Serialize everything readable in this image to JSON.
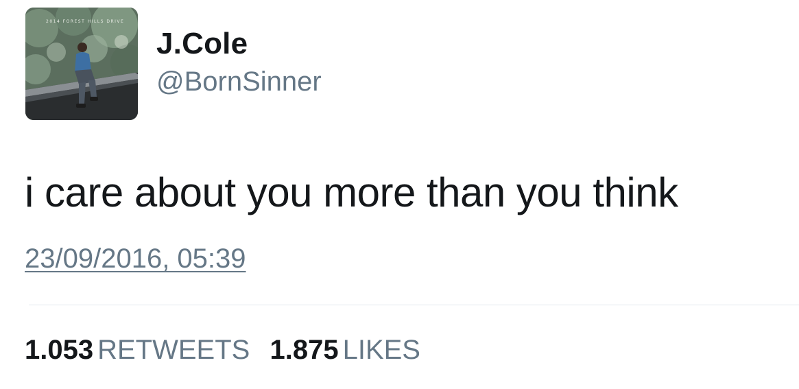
{
  "user": {
    "display_name": "J.Cole",
    "handle": "@BornSinner",
    "avatar_caption": "2014 FOREST HILLS DRIVE"
  },
  "tweet": {
    "text": "i care about you more than you think",
    "timestamp": "23/09/2016, 05:39"
  },
  "stats": {
    "retweets_count": "1.053",
    "retweets_label": "RETWEETS",
    "likes_count": "1.875",
    "likes_label": "LIKES"
  },
  "colors": {
    "primary_text": "#14171a",
    "secondary_text": "#657786",
    "divider": "#e1e8ed"
  }
}
